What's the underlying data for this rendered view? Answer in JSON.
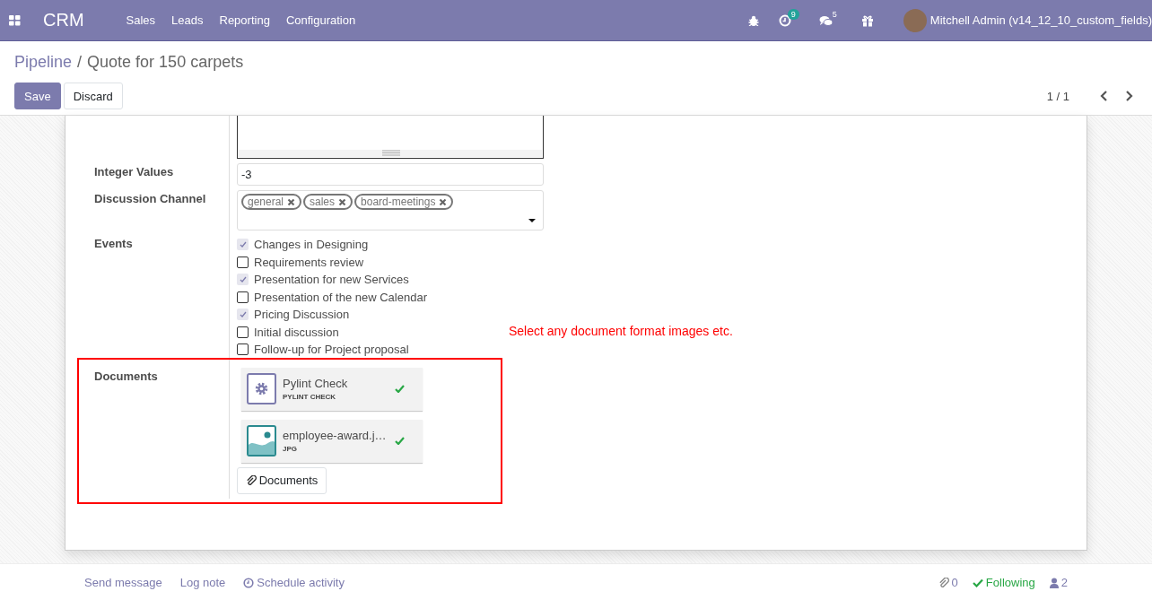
{
  "navbar": {
    "app_name": "CRM",
    "menu": [
      "Sales",
      "Leads",
      "Reporting",
      "Configuration"
    ],
    "activity_badge": "9",
    "message_badge": "5",
    "user": "Mitchell Admin (v14_12_10_custom_fields)"
  },
  "control_panel": {
    "breadcrumb": {
      "parent": "Pipeline",
      "separator": "/",
      "current": "Quote for 150 carpets"
    },
    "buttons": [
      {
        "label": "Save",
        "kind": "primary"
      },
      {
        "label": "Discard",
        "kind": "secondary"
      }
    ],
    "pager": "1 / 1"
  },
  "form": {
    "fields": [
      {
        "kind": "textarea"
      },
      {
        "kind": "integer",
        "label": "Integer Values",
        "value": "-3"
      },
      {
        "kind": "tags",
        "label": "Discussion Channel",
        "tags": [
          "general",
          "sales",
          "board-meetings"
        ]
      },
      {
        "kind": "checklist",
        "label": "Events",
        "items": [
          {
            "label": "Changes in Designing",
            "checked": true
          },
          {
            "label": "Requirements review",
            "checked": false
          },
          {
            "label": "Presentation for new Services",
            "checked": true
          },
          {
            "label": "Presentation of the new Calendar",
            "checked": false
          },
          {
            "label": "Pricing Discussion",
            "checked": true
          },
          {
            "label": "Initial discussion",
            "checked": false
          },
          {
            "label": "Follow-up for Project proposal",
            "checked": false
          }
        ]
      },
      {
        "kind": "documents",
        "label": "Documents",
        "files": [
          {
            "name": "Pylint Check",
            "type": "PYLINT CHECK",
            "kind": "gear",
            "uploaded": true
          },
          {
            "name": "employee-award.j…",
            "type": "JPG",
            "kind": "image",
            "uploaded": true
          }
        ],
        "button": "Documents"
      }
    ],
    "annotation": "Select any document format images etc."
  },
  "chatter": {
    "actions": [
      "Send message",
      "Log note",
      "Schedule activity"
    ],
    "attachments": "0",
    "follow": "Following",
    "followers": "2"
  }
}
